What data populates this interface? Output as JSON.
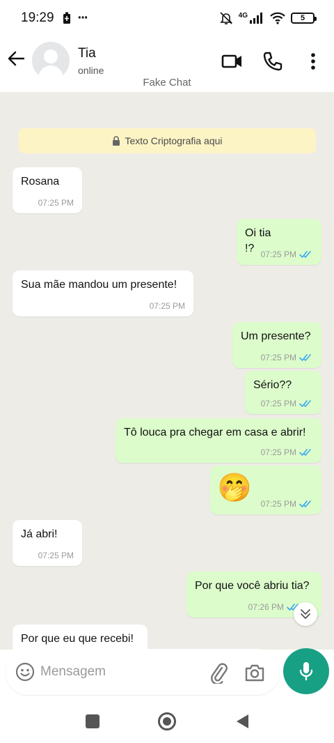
{
  "status_bar": {
    "time": "19:29",
    "ellipsis": "···",
    "network": "4G",
    "battery": "5"
  },
  "header": {
    "contact_name": "Tia",
    "contact_status": "online",
    "watermark": "Fake Chat"
  },
  "chat": {
    "encryption_notice": "Texto Criptografia aqui",
    "messages": [
      {
        "direction": "in",
        "text": "Rosana",
        "time": "07:25 PM"
      },
      {
        "direction": "out",
        "text": "Oi tia",
        "text2": "!?",
        "time": "07:25 PM",
        "read": true
      },
      {
        "direction": "in",
        "text": "Sua mãe mandou um presente!",
        "time": "07:25 PM"
      },
      {
        "direction": "out",
        "text": "Um presente?",
        "time": "07:25 PM",
        "read": true
      },
      {
        "direction": "out",
        "text": "Sério??",
        "time": "07:25 PM",
        "read": true
      },
      {
        "direction": "out",
        "text": "Tô louca pra chegar em casa e abrir!",
        "time": "07:25 PM",
        "read": true
      },
      {
        "direction": "out",
        "text": "🤭",
        "time": "07:25 PM",
        "read": true
      },
      {
        "direction": "in",
        "text": "Já abri!",
        "time": "07:25 PM"
      },
      {
        "direction": "out",
        "text": "Por que você abriu tia?",
        "time": "07:26 PM",
        "read": true
      },
      {
        "direction": "in",
        "text": "Por que eu que recebi!",
        "time": ""
      }
    ]
  },
  "composer": {
    "placeholder": "Mensagem"
  },
  "colors": {
    "chat_background": "#eeece7",
    "incoming_bubble": "#ffffff",
    "outgoing_bubble": "#dcfccb",
    "read_ticks": "#3aa8f0",
    "mic_button": "#18a085",
    "encryption_notice_bg": "#fdf4c5"
  },
  "icons": {
    "back": "arrow-left-icon",
    "video": "video-camera-icon",
    "call": "phone-icon",
    "menu": "more-vertical-icon",
    "emoji": "smiley-icon",
    "attach": "paperclip-icon",
    "camera": "camera-icon",
    "mic": "microphone-icon",
    "scroll": "double-chevron-down-icon"
  }
}
